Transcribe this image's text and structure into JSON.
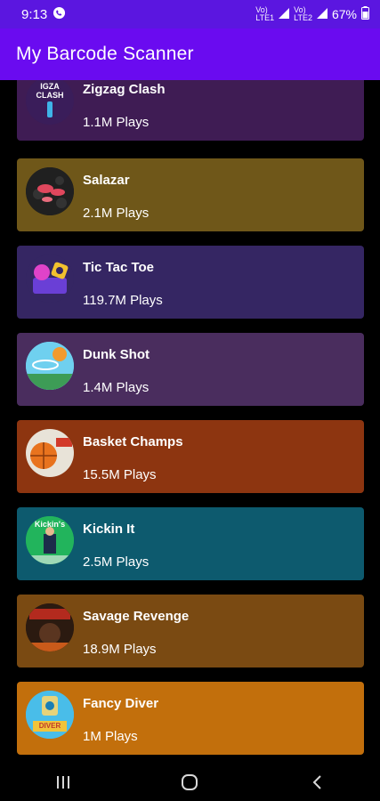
{
  "status_bar": {
    "time": "9:13",
    "battery": "67%",
    "signal_labels": [
      "Vo)",
      "LTE",
      "LTE1",
      "Vo)",
      "LTE2"
    ]
  },
  "app_bar": {
    "title": "My Barcode Scanner"
  },
  "games": [
    {
      "title": "Zigzag Clash",
      "plays": "1.1M Plays",
      "color": "#3f1c54",
      "thumb_text": "IGZA CLASH"
    },
    {
      "title": "Salazar",
      "plays": "2.1M Plays",
      "color": "#6f5719"
    },
    {
      "title": "Tic Tac Toe",
      "plays": "119.7M Plays",
      "color": "#352663"
    },
    {
      "title": "Dunk Shot",
      "plays": "1.4M Plays",
      "color": "#4a2d5e"
    },
    {
      "title": "Basket Champs",
      "plays": "15.5M Plays",
      "color": "#8d3510"
    },
    {
      "title": "Kickin It",
      "plays": "2.5M Plays",
      "color": "#0d5a6e",
      "thumb_text": "Kickin's"
    },
    {
      "title": "Savage Revenge",
      "plays": "18.9M Plays",
      "color": "#7a4a12"
    },
    {
      "title": "Fancy Diver",
      "plays": "1M Plays",
      "color": "#c26f0c",
      "thumb_text": "DIVER"
    }
  ],
  "icons": {
    "whatsapp": "whatsapp-icon",
    "battery": "battery-icon",
    "recents": "recents-icon",
    "home": "home-icon",
    "back": "back-icon"
  }
}
